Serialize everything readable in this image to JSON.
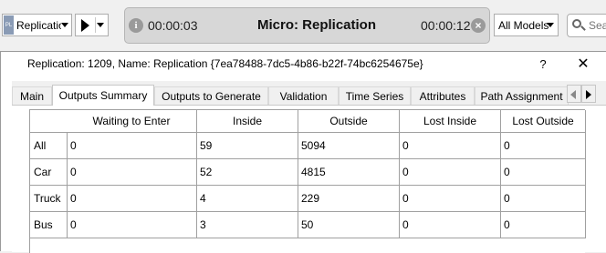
{
  "toolbar": {
    "replication_select": {
      "pl_icon": "PL",
      "value": "Replicatio"
    },
    "play_button": {
      "icon": "play-icon"
    },
    "simulation": {
      "start_time": "00:00:03",
      "title": "Micro: Replication",
      "end_time": "00:00:12"
    },
    "models_select": {
      "value": "All Models"
    },
    "search": {
      "placeholder": "Sea"
    }
  },
  "dialog": {
    "title": "Replication: 1209, Name: Replication  {7ea78488-7dc5-4b86-b22f-74bc6254675e}",
    "help_label": "?",
    "close_label": "✕",
    "tabs": [
      {
        "label": "Main",
        "active": false
      },
      {
        "label": "Outputs Summary",
        "active": true
      },
      {
        "label": "Outputs to Generate",
        "active": false
      },
      {
        "label": "Validation",
        "active": false
      },
      {
        "label": "Time Series",
        "active": false
      },
      {
        "label": "Attributes",
        "active": false
      },
      {
        "label": "Path Assignment",
        "active": false
      }
    ]
  },
  "table": {
    "columns": [
      "Waiting to Enter",
      "Inside",
      "Outside",
      "Lost Inside",
      "Lost Outside"
    ],
    "rows": [
      {
        "label": "All",
        "values": [
          "0",
          "59",
          "5094",
          "0",
          "0"
        ]
      },
      {
        "label": "Car",
        "values": [
          "0",
          "52",
          "4815",
          "0",
          "0"
        ]
      },
      {
        "label": "Truck",
        "values": [
          "0",
          "4",
          "229",
          "0",
          "0"
        ]
      },
      {
        "label": "Bus",
        "values": [
          "0",
          "3",
          "50",
          "0",
          "0"
        ]
      }
    ]
  }
}
